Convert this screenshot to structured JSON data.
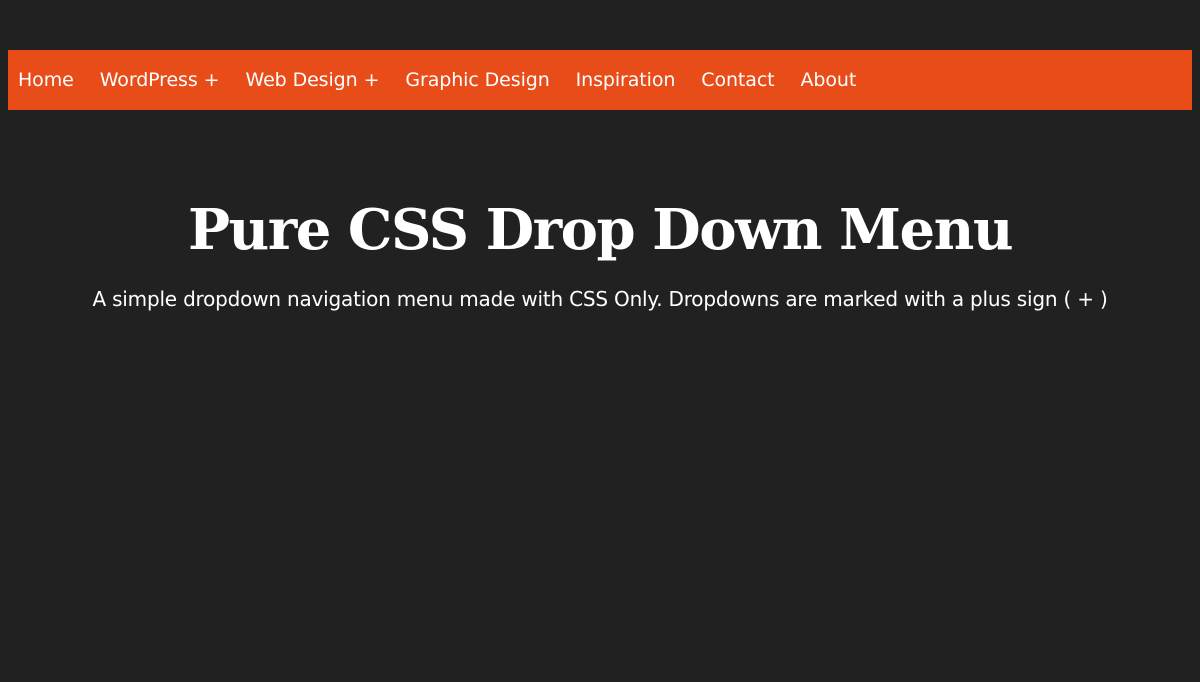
{
  "colors": {
    "background": "#212121",
    "navbar": "#e84c19",
    "text": "#ffffff"
  },
  "nav": {
    "items": [
      {
        "label": "Home",
        "plus": ""
      },
      {
        "label": "WordPress",
        "plus": "+"
      },
      {
        "label": "Web Design",
        "plus": "+"
      },
      {
        "label": "Graphic Design",
        "plus": ""
      },
      {
        "label": "Inspiration",
        "plus": ""
      },
      {
        "label": "Contact",
        "plus": ""
      },
      {
        "label": "About",
        "plus": ""
      }
    ]
  },
  "hero": {
    "title": "Pure CSS Drop Down Menu",
    "subtitle": "A simple dropdown navigation menu made with CSS Only. Dropdowns are marked with a plus sign ( + )"
  }
}
